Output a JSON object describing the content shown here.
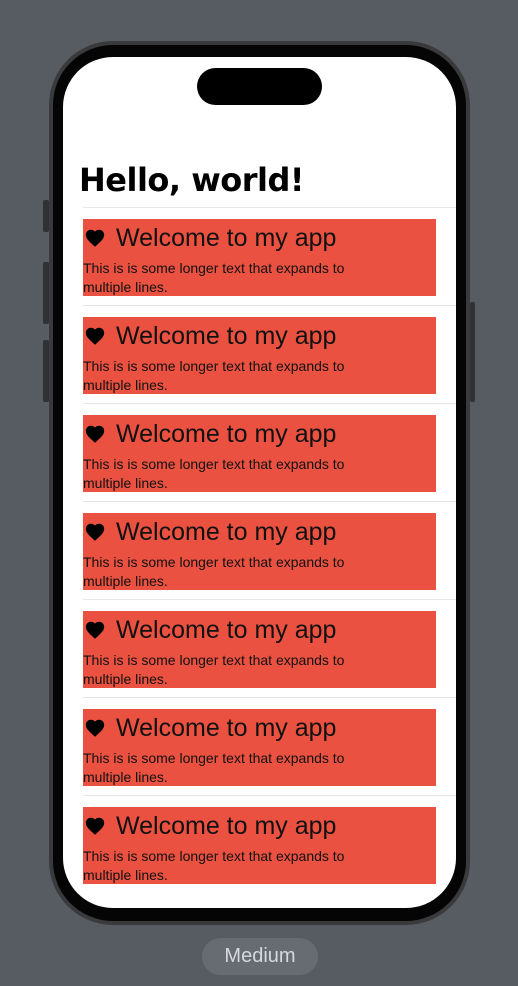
{
  "screen": {
    "title": "Hello, world!"
  },
  "rows": [
    {
      "icon": "heart-icon",
      "title": "Welcome to my app",
      "body": "This is is some longer text that expands to multiple  lines."
    },
    {
      "icon": "heart-icon",
      "title": "Welcome to my app",
      "body": "This is is some longer text that expands to multiple  lines."
    },
    {
      "icon": "heart-icon",
      "title": "Welcome to my app",
      "body": "This is is some longer text that expands to multiple  lines."
    },
    {
      "icon": "heart-icon",
      "title": "Welcome to my app",
      "body": "This is is some longer text that expands to multiple  lines."
    },
    {
      "icon": "heart-icon",
      "title": "Welcome to my app",
      "body": "This is is some longer text that expands to multiple  lines."
    },
    {
      "icon": "heart-icon",
      "title": "Welcome to my app",
      "body": "This is is some longer text that expands to multiple  lines."
    },
    {
      "icon": "heart-icon",
      "title": "Welcome to my app",
      "body": "This is is some longer text that expands to multiple  lines."
    }
  ],
  "colors": {
    "card": "#ea5140",
    "background": "#575c63"
  },
  "preview_control": {
    "label": "Medium"
  }
}
